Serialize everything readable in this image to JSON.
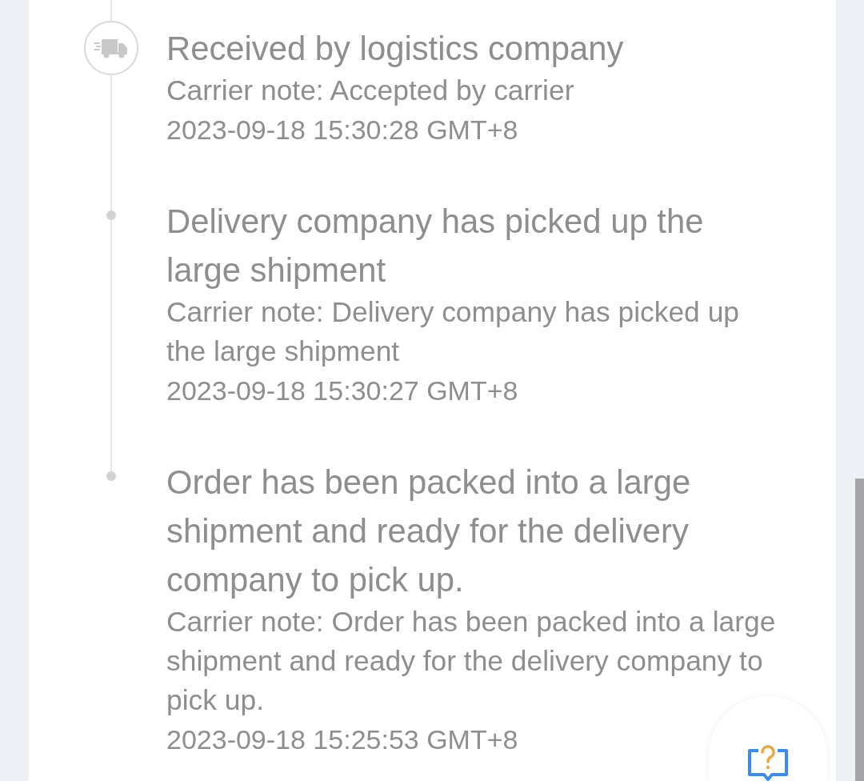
{
  "timeline": [
    {
      "kind": "truck",
      "title": "Received by logistics company",
      "note": "Carrier note: Accepted by carrier",
      "time": "2023-09-18 15:30:28 GMT+8"
    },
    {
      "kind": "dot",
      "title": "Delivery company has picked up the large shipment",
      "note": "Carrier note: Delivery company has picked up the large shipment",
      "time": "2023-09-18 15:30:27 GMT+8"
    },
    {
      "kind": "dot",
      "title": "Order has been packed into a large shipment and ready for the delivery company to pick up.",
      "note": "Carrier note: Order has been packed into a large shipment and ready for the delivery company to pick up.",
      "time": "2023-09-18 15:25:53 GMT+8"
    }
  ]
}
